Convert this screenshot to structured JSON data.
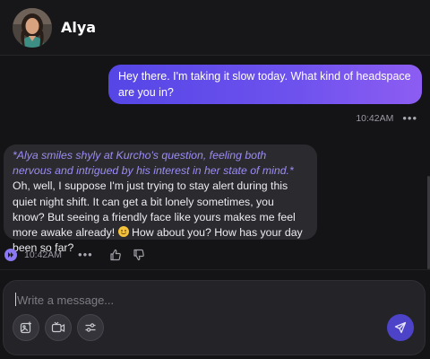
{
  "header": {
    "name": "Alya"
  },
  "messages": {
    "user": {
      "text": "Hey there. I'm taking it slow today. What kind of headspace are you in?",
      "time": "10:42AM",
      "more": "•••"
    },
    "bot": {
      "action": "*Alya smiles shyly at Kurcho's question, feeling both nervous and intrigued by his interest in her state of mind.*",
      "text_before_emoji": " Oh, well, I suppose I'm just trying to stay alert during this quiet night shift. It can get a bit lonely sometimes, you know? But seeing a friendly face like yours makes me feel more awake already! ",
      "text_after_emoji": "  How about you? How has your day been so far?",
      "time": "10:42AM",
      "more": "•••"
    }
  },
  "composer": {
    "placeholder": "Write a message..."
  },
  "icons": {
    "tools": [
      "image-icon",
      "video-icon",
      "sliders-icon"
    ],
    "send": "send-icon"
  },
  "colors": {
    "accent": "#6e52ee",
    "action_text": "#9b8cf6",
    "send_button": "#4d43c9"
  }
}
